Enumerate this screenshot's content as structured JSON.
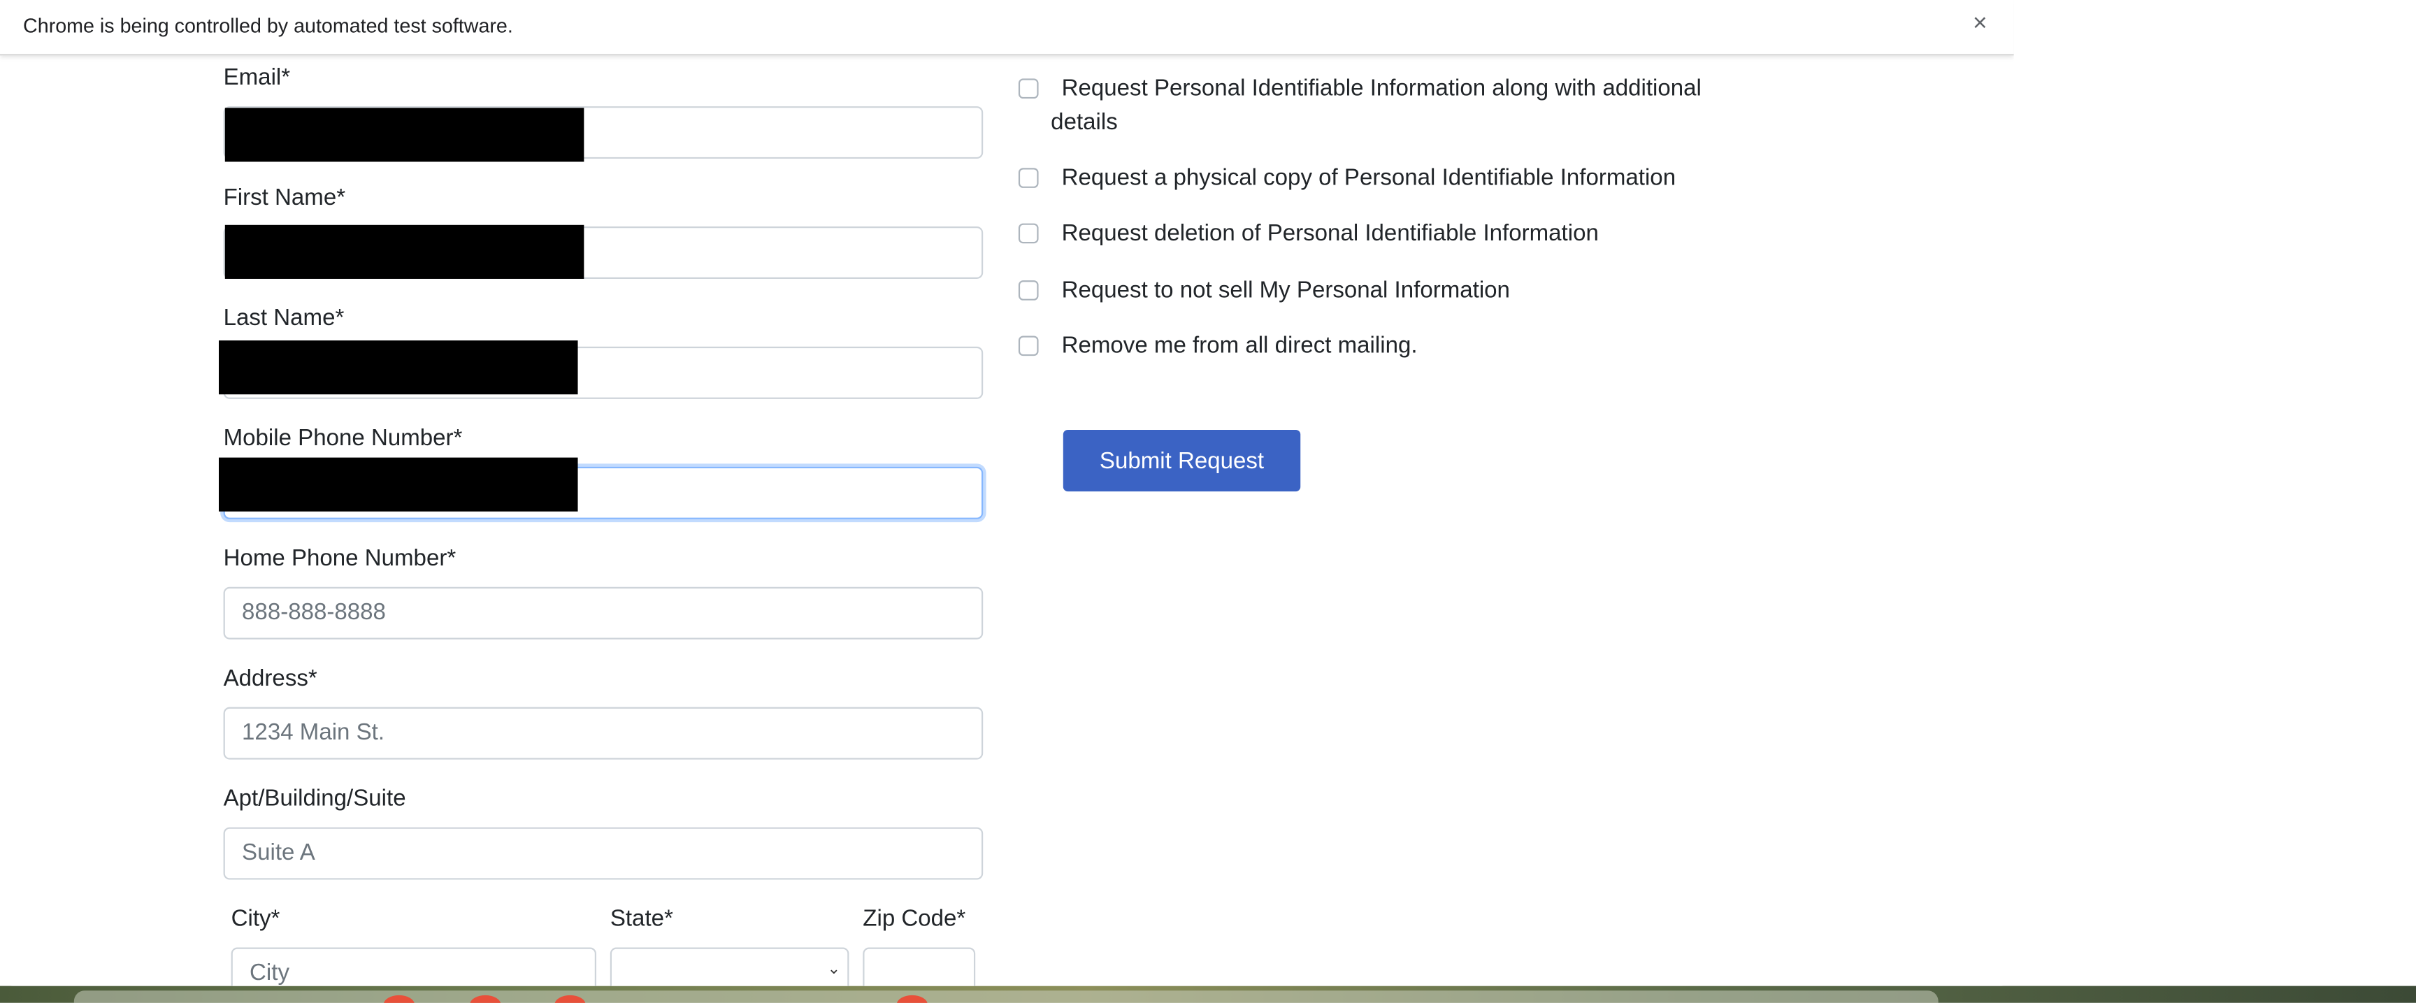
{
  "infobar": {
    "message": "Chrome is being controlled by automated test software.",
    "close_icon": "close-icon",
    "close_glyph": "×"
  },
  "form": {
    "email_label": "Email*",
    "first_name_label": "First Name*",
    "last_name_label": "Last Name*",
    "mobile_label": "Mobile Phone Number*",
    "home_phone_label": "Home Phone Number*",
    "home_phone_placeholder": "888-888-8888",
    "address_label": "Address*",
    "address_placeholder": "1234 Main St.",
    "apt_label": "Apt/Building/Suite",
    "apt_placeholder": "Suite A",
    "city_label": "City*",
    "city_placeholder": "City",
    "state_label": "State*",
    "state_value": "",
    "zip_label": "Zip Code*"
  },
  "requests": {
    "items": [
      {
        "label_line1": "Request Personal Identifiable Information along with additional",
        "label_line2": "details",
        "checked": false
      },
      {
        "label": "Request a physical copy of Personal Identifiable Information",
        "checked": false
      },
      {
        "label": "Request deletion of Personal Identifiable Information",
        "checked": false
      },
      {
        "label": "Request to not sell My Personal Information",
        "checked": false
      },
      {
        "label": "Remove me from all direct mailing.",
        "checked": false
      }
    ]
  },
  "submit_label": "Submit Request",
  "colors": {
    "primary_button": "#3b63c4",
    "focus_border": "#86b7fe"
  }
}
